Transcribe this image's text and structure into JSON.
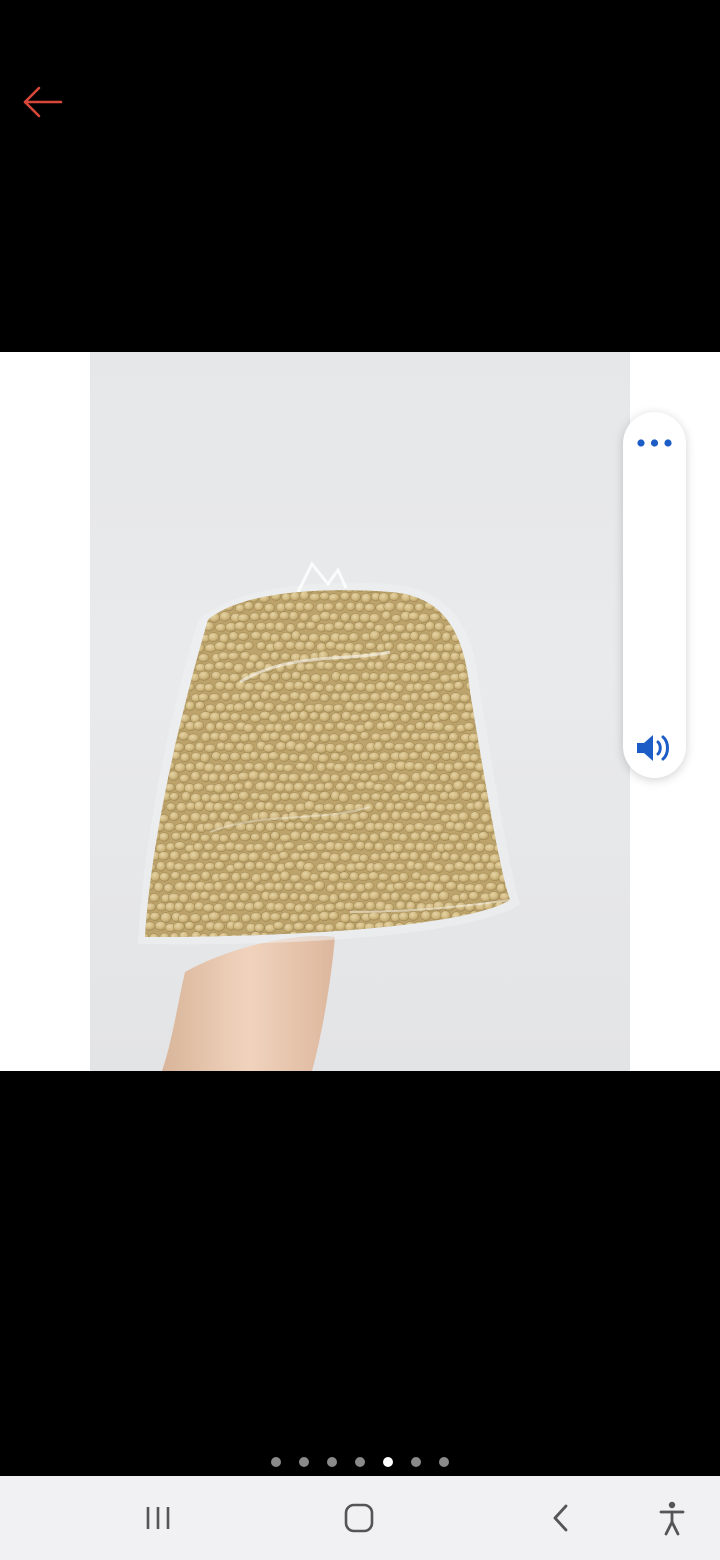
{
  "colors": {
    "background": "#000000",
    "back_arrow": "#d9473a",
    "accent_blue": "#1b5cc6",
    "nav_bar": "#f1f1f3",
    "dot_inactive": "#8a8a8a",
    "dot_active": "#ffffff"
  },
  "toolbar": {
    "back_icon": "arrow-left-icon"
  },
  "viewer": {
    "image_subject": "soybeans-in-plastic-bag",
    "total_images": 7,
    "current_index": 5
  },
  "side_panel": {
    "more_icon": "more-horizontal-icon",
    "speaker_icon": "speaker-volume-icon"
  },
  "nav_bar": {
    "recents_icon": "recents-icon",
    "home_icon": "home-icon",
    "back_icon": "back-chevron-icon",
    "accessibility_icon": "accessibility-icon"
  }
}
